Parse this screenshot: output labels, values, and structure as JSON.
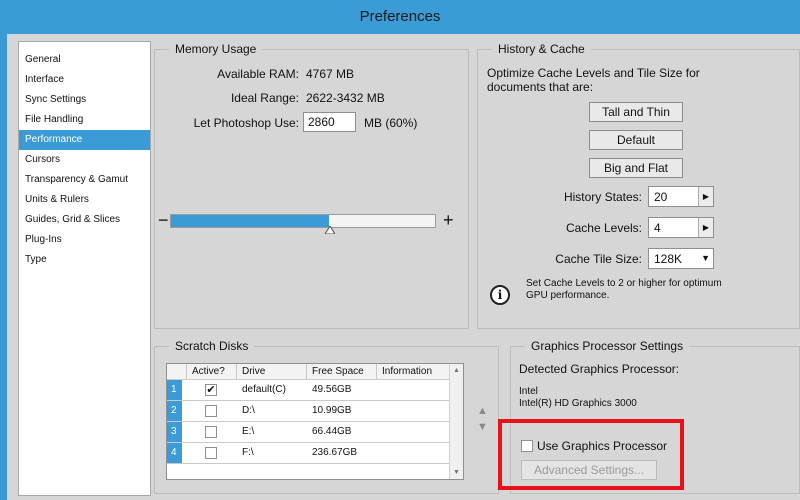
{
  "window": {
    "title": "Preferences"
  },
  "nav": {
    "items": [
      {
        "label": "General",
        "selected": false
      },
      {
        "label": "Interface",
        "selected": false
      },
      {
        "label": "Sync Settings",
        "selected": false
      },
      {
        "label": "File Handling",
        "selected": false
      },
      {
        "label": "Performance",
        "selected": true
      },
      {
        "label": "Cursors",
        "selected": false
      },
      {
        "label": "Transparency & Gamut",
        "selected": false
      },
      {
        "label": "Units & Rulers",
        "selected": false
      },
      {
        "label": "Guides, Grid & Slices",
        "selected": false
      },
      {
        "label": "Plug-Ins",
        "selected": false
      },
      {
        "label": "Type",
        "selected": false
      }
    ]
  },
  "memory": {
    "legend": "Memory Usage",
    "available_label": "Available RAM:",
    "available_value": "4767 MB",
    "ideal_label": "Ideal Range:",
    "ideal_value": "2622-3432 MB",
    "let_label": "Let Photoshop Use:",
    "let_value": "2860",
    "let_suffix": "MB (60%)",
    "slider_percent": 60,
    "minus": "−",
    "plus": "+"
  },
  "history": {
    "legend": "History & Cache",
    "description": "Optimize Cache Levels and Tile Size for documents that are:",
    "btn_tall": "Tall and Thin",
    "btn_default": "Default",
    "btn_big": "Big and Flat",
    "states_label": "History States:",
    "states_value": "20",
    "levels_label": "Cache Levels:",
    "levels_value": "4",
    "tile_label": "Cache Tile Size:",
    "tile_value": "128K",
    "info_icon": "i",
    "note": "Set Cache Levels to 2 or higher for optimum GPU performance."
  },
  "scratch": {
    "legend": "Scratch Disks",
    "headers": [
      "Active?",
      "Drive",
      "Free Space",
      "Information"
    ],
    "rows": [
      {
        "num": "1",
        "active": true,
        "drive": "default(C)",
        "free": "49.56GB",
        "info": ""
      },
      {
        "num": "2",
        "active": false,
        "drive": "D:\\",
        "free": "10.99GB",
        "info": ""
      },
      {
        "num": "3",
        "active": false,
        "drive": "E:\\",
        "free": "66.44GB",
        "info": ""
      },
      {
        "num": "4",
        "active": false,
        "drive": "F:\\",
        "free": "236.67GB",
        "info": ""
      }
    ],
    "check_glyph": "✔"
  },
  "gpu": {
    "legend": "Graphics Processor Settings",
    "detected_label": "Detected Graphics Processor:",
    "vendor": "Intel",
    "model": "Intel(R) HD Graphics 3000",
    "use_label": "Use Graphics Processor",
    "use_checked": false,
    "advanced_label": "Advanced Settings..."
  },
  "colors": {
    "accent": "#3a9bd6",
    "panel": "#d6d6d6",
    "highlight": "#e8101a"
  }
}
